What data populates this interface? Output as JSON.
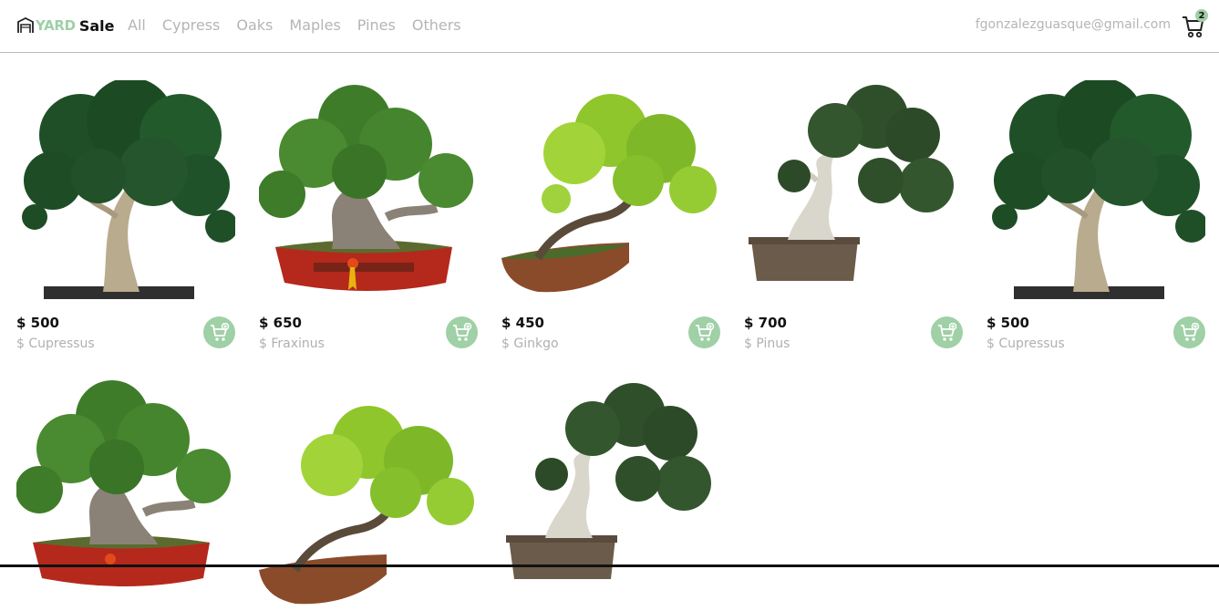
{
  "brand": {
    "yard": "YARD",
    "sale": "Sale",
    "icon": "garage-icon"
  },
  "nav": [
    "All",
    "Cypress",
    "Oaks",
    "Maples",
    "Pines",
    "Others"
  ],
  "user": {
    "email": "fgonzalezguasque@gmail.com"
  },
  "cart": {
    "count": "2",
    "icon": "cart-icon"
  },
  "colors": {
    "accent": "#9fd0a6",
    "muted": "#b5b5b5",
    "text": "#111111",
    "divider": "#b9b9b9"
  },
  "products": [
    {
      "price": "$ 500",
      "species": "$ Cupressus",
      "tree": "cypress"
    },
    {
      "price": "$ 650",
      "species": "$ Fraxinus",
      "tree": "fraxinus"
    },
    {
      "price": "$ 450",
      "species": "$ Ginkgo",
      "tree": "ginkgo"
    },
    {
      "price": "$ 700",
      "species": "$ Pinus",
      "tree": "pine"
    },
    {
      "price": "$ 500",
      "species": "$ Cupressus",
      "tree": "cypress"
    },
    {
      "tree": "fraxinus"
    },
    {
      "tree": "ginkgo"
    },
    {
      "tree": "pine"
    }
  ]
}
